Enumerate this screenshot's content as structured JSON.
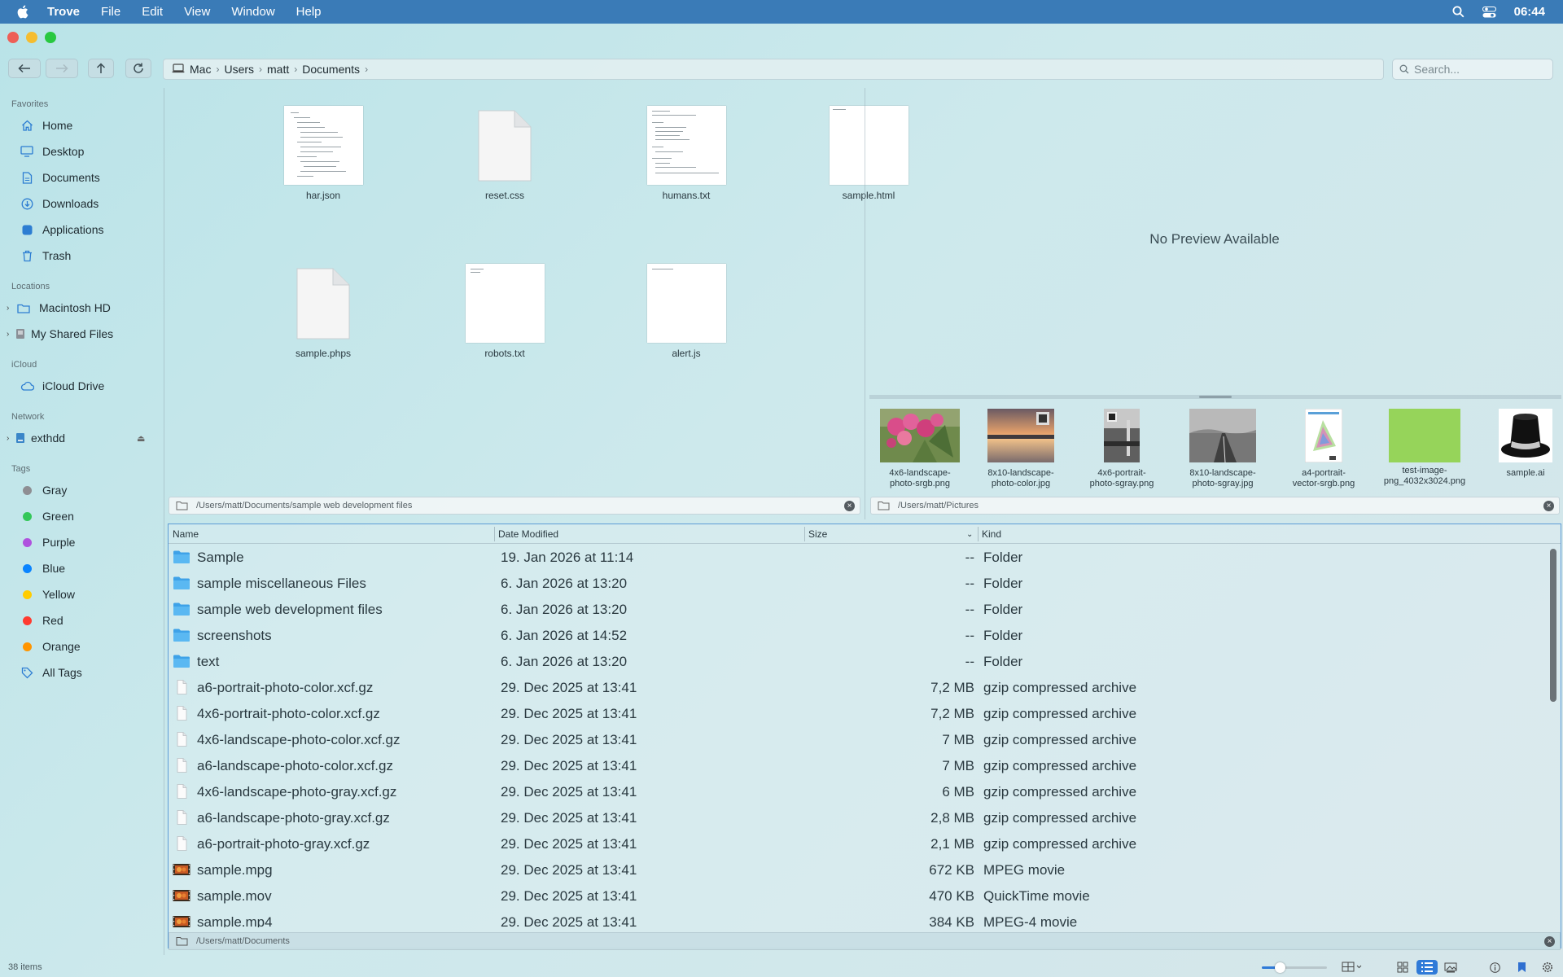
{
  "menubar": {
    "app": "Trove",
    "items": [
      "File",
      "Edit",
      "View",
      "Window",
      "Help"
    ],
    "clock": "06:44"
  },
  "path": {
    "crumbs": [
      "Mac",
      "Users",
      "matt",
      "Documents"
    ]
  },
  "search": {
    "placeholder": "Search..."
  },
  "sidebar": {
    "favorites_header": "Favorites",
    "favorites": [
      "Home",
      "Desktop",
      "Documents",
      "Downloads",
      "Applications",
      "Trash"
    ],
    "locations_header": "Locations",
    "locations": [
      "Macintosh HD",
      "My Shared Files"
    ],
    "icloud_header": "iCloud",
    "icloud": [
      "iCloud Drive"
    ],
    "network_header": "Network",
    "network": [
      "exthdd"
    ],
    "tags_header": "Tags",
    "tags": [
      {
        "label": "Gray",
        "color": "#8e8e93"
      },
      {
        "label": "Green",
        "color": "#34c759"
      },
      {
        "label": "Purple",
        "color": "#af52de"
      },
      {
        "label": "Blue",
        "color": "#0a84ff"
      },
      {
        "label": "Yellow",
        "color": "#ffcc00"
      },
      {
        "label": "Red",
        "color": "#ff3b30"
      },
      {
        "label": "Orange",
        "color": "#ff9500"
      }
    ],
    "all_tags": "All Tags"
  },
  "left_pane": {
    "files": [
      "har.json",
      "reset.css",
      "humans.txt",
      "sample.html",
      "sample.phps",
      "robots.txt",
      "alert.js"
    ],
    "path": "/Users/matt/Documents/sample web development files"
  },
  "right_pane": {
    "no_preview": "No Preview Available",
    "strip": [
      {
        "l1": "4x6-landscape-",
        "l2": "photo-srgb.png"
      },
      {
        "l1": "8x10-landscape-",
        "l2": "photo-color.jpg"
      },
      {
        "l1": "4x6-portrait-",
        "l2": "photo-sgray.png"
      },
      {
        "l1": "8x10-landscape-",
        "l2": "photo-sgray.jpg"
      },
      {
        "l1": "a4-portrait-",
        "l2": "vector-srgb.png"
      },
      {
        "l1": "test-image-",
        "l2": "png_4032x3024.png"
      },
      {
        "l1": "sample.ai",
        "l2": ""
      }
    ],
    "path": "/Users/matt/Pictures"
  },
  "list": {
    "columns": {
      "name": "Name",
      "date": "Date Modified",
      "size": "Size",
      "kind": "Kind"
    },
    "rows": [
      {
        "name": "Sample",
        "date": "19. Jan 2026 at 11:14",
        "size": "--",
        "kind": "Folder",
        "type": "folder"
      },
      {
        "name": "sample miscellaneous Files",
        "date": "6. Jan 2026 at 13:20",
        "size": "--",
        "kind": "Folder",
        "type": "folder"
      },
      {
        "name": "sample web development files",
        "date": "6. Jan 2026 at 13:20",
        "size": "--",
        "kind": "Folder",
        "type": "folder"
      },
      {
        "name": "screenshots",
        "date": "6. Jan 2026 at 14:52",
        "size": "--",
        "kind": "Folder",
        "type": "folder"
      },
      {
        "name": "text",
        "date": "6. Jan 2026 at 13:20",
        "size": "--",
        "kind": "Folder",
        "type": "folder"
      },
      {
        "name": "a6-portrait-photo-color.xcf.gz",
        "date": "29. Dec 2025 at 13:41",
        "size": "7,2 MB",
        "kind": "gzip compressed archive",
        "type": "file"
      },
      {
        "name": "4x6-portrait-photo-color.xcf.gz",
        "date": "29. Dec 2025 at 13:41",
        "size": "7,2 MB",
        "kind": "gzip compressed archive",
        "type": "file"
      },
      {
        "name": "4x6-landscape-photo-color.xcf.gz",
        "date": "29. Dec 2025 at 13:41",
        "size": "7 MB",
        "kind": "gzip compressed archive",
        "type": "file"
      },
      {
        "name": "a6-landscape-photo-color.xcf.gz",
        "date": "29. Dec 2025 at 13:41",
        "size": "7 MB",
        "kind": "gzip compressed archive",
        "type": "file"
      },
      {
        "name": "4x6-landscape-photo-gray.xcf.gz",
        "date": "29. Dec 2025 at 13:41",
        "size": "6 MB",
        "kind": "gzip compressed archive",
        "type": "file"
      },
      {
        "name": "a6-landscape-photo-gray.xcf.gz",
        "date": "29. Dec 2025 at 13:41",
        "size": "2,8 MB",
        "kind": "gzip compressed archive",
        "type": "file"
      },
      {
        "name": "a6-portrait-photo-gray.xcf.gz",
        "date": "29. Dec 2025 at 13:41",
        "size": "2,1 MB",
        "kind": "gzip compressed archive",
        "type": "file"
      },
      {
        "name": "sample.mpg",
        "date": "29. Dec 2025 at 13:41",
        "size": "672 KB",
        "kind": "MPEG movie",
        "type": "movie"
      },
      {
        "name": "sample.mov",
        "date": "29. Dec 2025 at 13:41",
        "size": "470 KB",
        "kind": "QuickTime movie",
        "type": "movie"
      },
      {
        "name": "sample.mp4",
        "date": "29. Dec 2025 at 13:41",
        "size": "384 KB",
        "kind": "MPEG-4 movie",
        "type": "movie"
      }
    ],
    "path": "/Users/matt/Documents"
  },
  "status": {
    "count": "38 items"
  }
}
